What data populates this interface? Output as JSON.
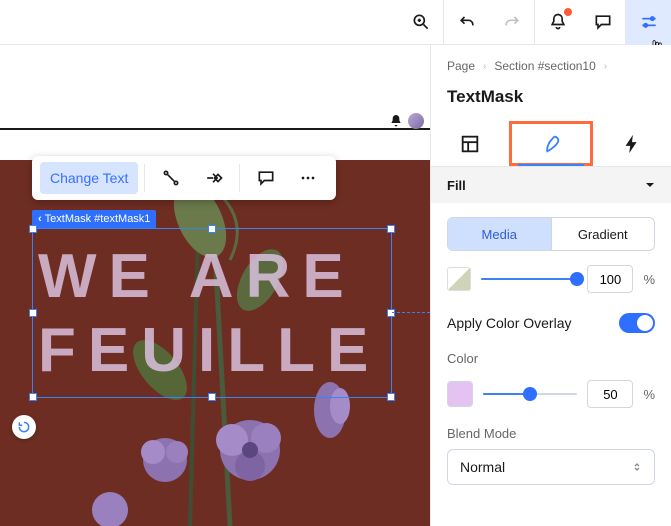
{
  "toolbar": {
    "change_text": "Change Text"
  },
  "selection": {
    "label": "TextMask #textMask1",
    "text": "WE ARE\nFEUILLE"
  },
  "crumbs": {
    "page": "Page",
    "section": "Section #section10"
  },
  "panel_title": "TextMask",
  "accordion": {
    "fill": "Fill"
  },
  "fill": {
    "media": "Media",
    "gradient": "Gradient",
    "opacity": "100",
    "overlay_label": "Apply Color Overlay",
    "color_label": "Color",
    "color_value": "50",
    "blend_label": "Blend Mode",
    "blend_value": "Normal"
  }
}
